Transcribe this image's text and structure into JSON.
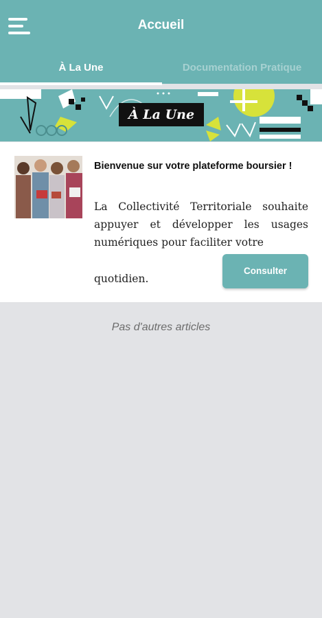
{
  "header": {
    "title": "Accueil",
    "menu_icon": "hamburger-menu-icon"
  },
  "tabs": [
    {
      "label": "À La Une",
      "active": true
    },
    {
      "label": "Documentation Pratique",
      "active": false
    }
  ],
  "banner": {
    "label": "À La Une"
  },
  "article": {
    "image": "students-photo",
    "title": "Bienvenue sur votre plateforme boursier !",
    "body": "La Collectivité Territoriale souhaite appuyer et développer les usages numériques pour faciliter votre",
    "body_end": "quotidien.",
    "button_label": "Consulter"
  },
  "footer_text": "Pas d'autres articles",
  "colors": {
    "primary": "#6bb3b3",
    "accent": "#d7e23a",
    "background": "#e2e3e6"
  }
}
